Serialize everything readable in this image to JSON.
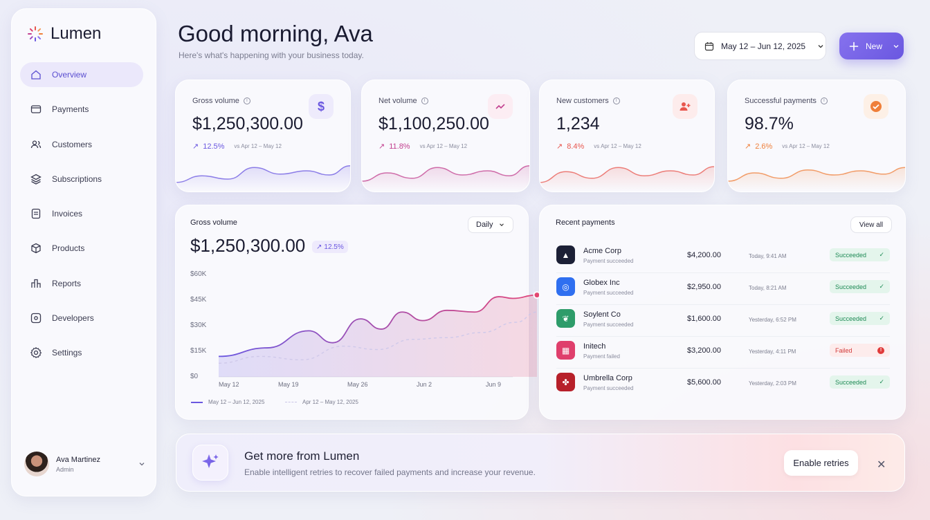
{
  "brand": {
    "name": "Lumen",
    "accent": "#6a57e0"
  },
  "sidebar": {
    "items": [
      {
        "label": "Overview",
        "icon": "home-icon",
        "active": true
      },
      {
        "label": "Payments",
        "icon": "wallet-icon"
      },
      {
        "label": "Customers",
        "icon": "users-icon"
      },
      {
        "label": "Subscriptions",
        "icon": "layers-icon"
      },
      {
        "label": "Invoices",
        "icon": "document-icon"
      },
      {
        "label": "Products",
        "icon": "box-icon"
      },
      {
        "label": "Reports",
        "icon": "reports-icon"
      },
      {
        "label": "Developers",
        "icon": "developers-icon"
      },
      {
        "label": "Settings",
        "icon": "gear-icon"
      }
    ],
    "user": {
      "name": "Ava Martinez",
      "role": "Admin"
    }
  },
  "header": {
    "greeting": "Good morning, Ava",
    "subtitle": "Here's what's happening with your business today.",
    "date_range": "May 12 – Jun 12, 2025",
    "new_label": "New"
  },
  "kpis": [
    {
      "title": "Gross volume",
      "value": "$1,250,300.00",
      "change": "12.5%",
      "vs": "vs Apr 12 – May 12",
      "icon": "dollar-icon",
      "color": "#6a57e0"
    },
    {
      "title": "Net volume",
      "value": "$1,100,250.00",
      "change": "11.8%",
      "vs": "vs Apr 12 – May 12",
      "icon": "trend-up-icon",
      "color": "#c2408f"
    },
    {
      "title": "New customers",
      "value": "1,234",
      "change": "8.4%",
      "vs": "vs Apr 12 – May 12",
      "icon": "user-plus-icon",
      "color": "#e8574f"
    },
    {
      "title": "Successful payments",
      "value": "98.7%",
      "change": "2.6%",
      "vs": "vs Apr 12 – May 12",
      "icon": "check-circle-icon",
      "color": "#ef7f3a"
    }
  ],
  "gross_panel": {
    "title": "Gross volume",
    "period": "Daily",
    "value": "$1,250,300.00",
    "change": "12.5%",
    "legend_current": "May 12 – Jun 12, 2025",
    "legend_previous": "Apr 12 – May 12, 2025"
  },
  "chart_data": {
    "type": "area",
    "x": [
      "May 12",
      "May 19",
      "May 26",
      "Jun 2",
      "Jun 9"
    ],
    "y_ticks": [
      "$60K",
      "$45K",
      "$30K",
      "$15K",
      "$0"
    ],
    "ylim": [
      0,
      60000
    ],
    "series": [
      {
        "name": "May 12 – Jun 12, 2025",
        "points": [
          [
            0,
            12000
          ],
          [
            0.7,
            17000
          ],
          [
            1.3,
            27000
          ],
          [
            1.65,
            20000
          ],
          [
            2.05,
            34000
          ],
          [
            2.35,
            28000
          ],
          [
            2.65,
            38000
          ],
          [
            2.95,
            33000
          ],
          [
            3.3,
            39000
          ],
          [
            3.7,
            38000
          ],
          [
            4.05,
            47000
          ],
          [
            4.25,
            46000
          ],
          [
            4.6,
            48000
          ]
        ]
      },
      {
        "name": "Apr 12 – May 12, 2025",
        "points": [
          [
            0,
            8000
          ],
          [
            0.6,
            12000
          ],
          [
            1.2,
            10000
          ],
          [
            1.8,
            18000
          ],
          [
            2.3,
            16000
          ],
          [
            2.8,
            22000
          ],
          [
            3.3,
            23000
          ],
          [
            3.8,
            26000
          ],
          [
            4.3,
            32000
          ],
          [
            4.6,
            38000
          ]
        ]
      }
    ]
  },
  "payments": {
    "title": "Recent payments",
    "view_all": "View all",
    "rows": [
      {
        "name": "Acme Corp",
        "sub": "Payment succeeded",
        "amount": "$4,200.00",
        "time": "Today, 9:41 AM",
        "status": "Succeeded",
        "status_icon": "✓",
        "logo": "acme-logo-icon",
        "glyph": "▲",
        "color": "#1c2036"
      },
      {
        "name": "Globex Inc",
        "sub": "Payment succeeded",
        "amount": "$2,950.00",
        "time": "Today, 8:21 AM",
        "status": "Succeeded",
        "status_icon": "✓",
        "logo": "globex-logo-icon",
        "glyph": "◎",
        "color": "#2f6ff0"
      },
      {
        "name": "Soylent Co",
        "sub": "Payment succeeded",
        "amount": "$1,600.00",
        "time": "Yesterday, 6:52 PM",
        "status": "Succeeded",
        "status_icon": "✓",
        "logo": "soylent-logo-icon",
        "glyph": "❦",
        "color": "#2e9c6a"
      },
      {
        "name": "Initech",
        "sub": "Payment failed",
        "amount": "$3,200.00",
        "time": "Yesterday, 4:11 PM",
        "status": "Failed",
        "status_icon": "!",
        "logo": "initech-logo-icon",
        "glyph": "▦",
        "color": "#df3f6c"
      },
      {
        "name": "Umbrella Corp",
        "sub": "Payment succeeded",
        "amount": "$5,600.00",
        "time": "Yesterday, 2:03 PM",
        "status": "Succeeded",
        "status_icon": "✓",
        "logo": "umbrella-logo-icon",
        "glyph": "✤",
        "color": "#b7202a"
      }
    ]
  },
  "promo": {
    "title": "Get more from Lumen",
    "subtitle": "Enable intelligent retries to recover failed payments and increase your revenue.",
    "button": "Enable retries"
  }
}
